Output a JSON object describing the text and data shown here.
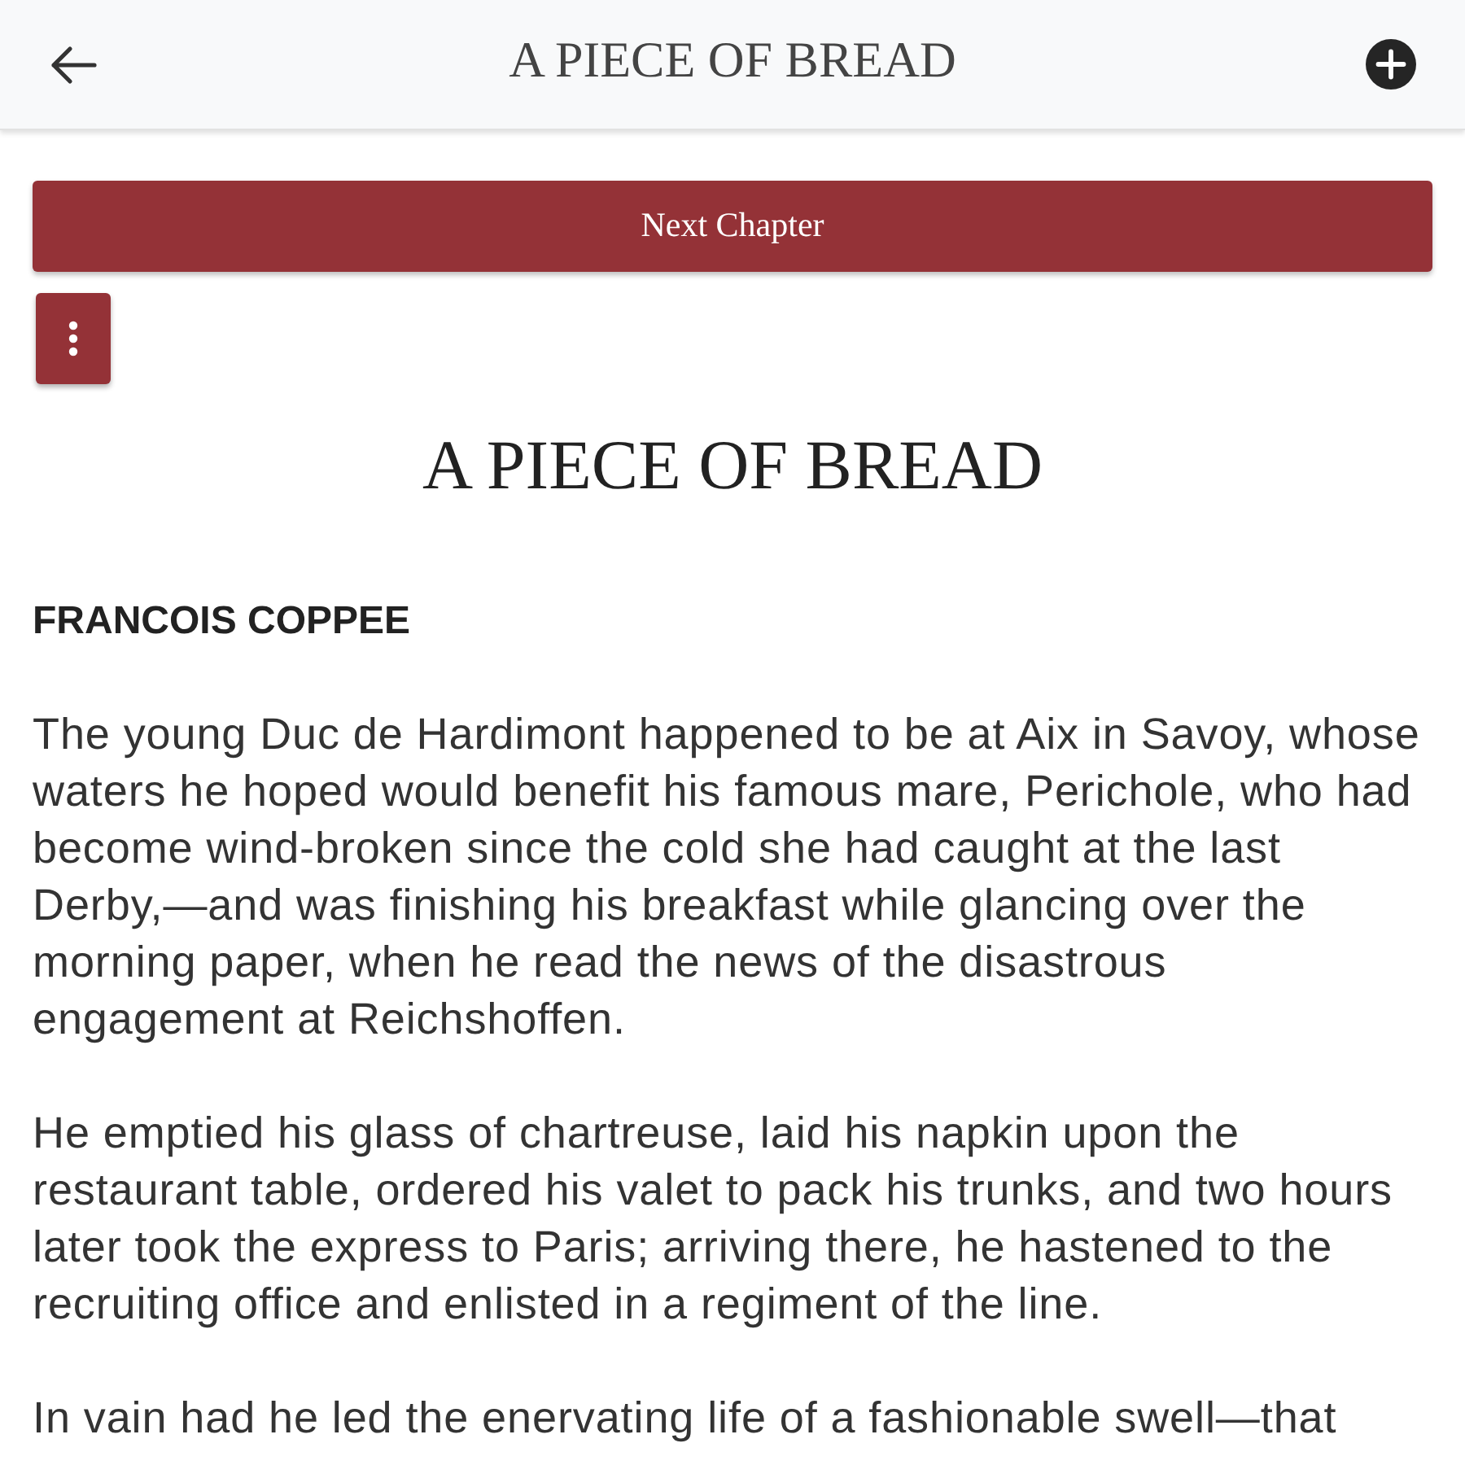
{
  "header": {
    "title": "A PIECE OF BREAD"
  },
  "next_chapter_button": {
    "label": "Next Chapter"
  },
  "chapter": {
    "title": "A PIECE OF BREAD",
    "author": "FRANCOIS COPPEE",
    "paragraphs": [
      {
        "lines": [
          "The young Duc de Hardimont happened to be at Aix in Savoy, whose",
          "waters he hoped would benefit his famous mare, Perichole, who had",
          "become wind-broken since the cold she had caught at the last",
          "Derby,—and was finishing his breakfast while glancing over the",
          "morning paper, when he read the news of the disastrous",
          "engagement at Reichshoffen."
        ]
      },
      {
        "lines": [
          "He emptied his glass of chartreuse, laid his napkin upon the",
          "restaurant table, ordered his valet to pack his trunks, and two hours",
          "later took the express to Paris; arriving there, he hastened to the",
          "recruiting office and enlisted in a regiment of the line."
        ]
      },
      {
        "lines": [
          "In vain had he led the enervating life of a fashionable swell—that"
        ]
      }
    ]
  }
}
